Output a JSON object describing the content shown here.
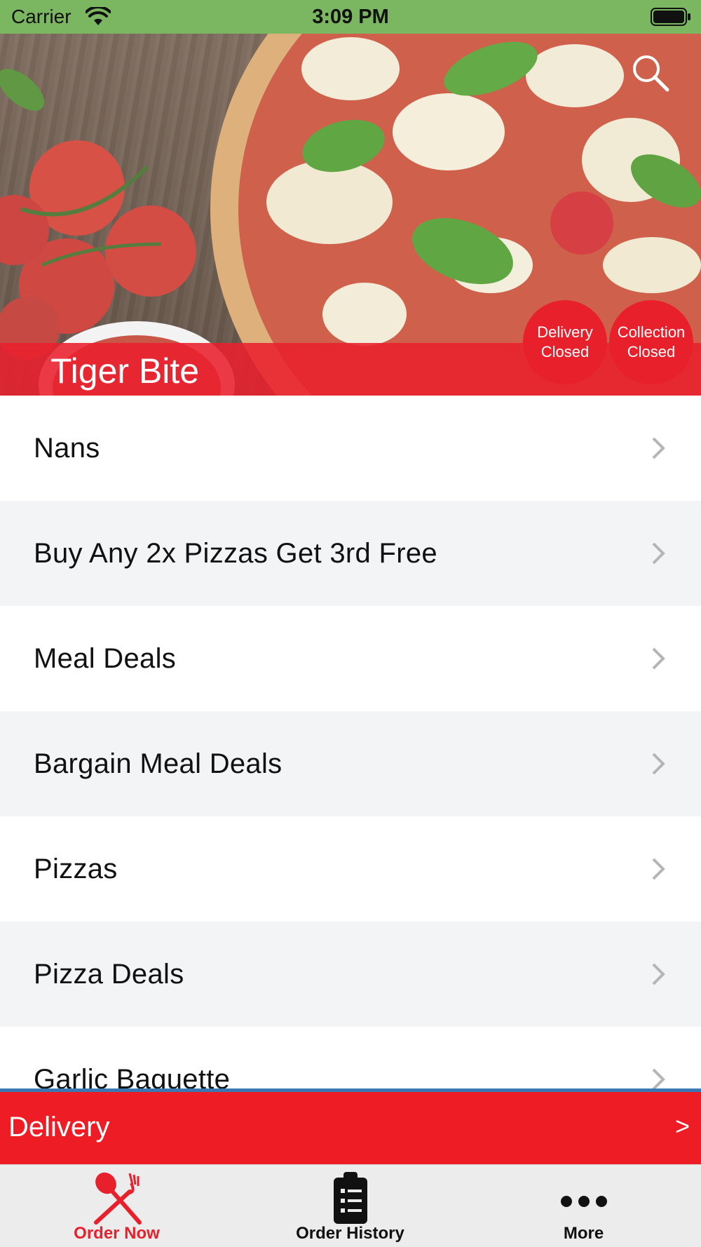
{
  "status_bar": {
    "carrier": "Carrier",
    "time": "3:09 PM"
  },
  "hero": {
    "restaurant_name": "Tiger Bite",
    "badges": [
      {
        "line1": "Delivery",
        "line2": "Closed"
      },
      {
        "line1": "Collection",
        "line2": "Closed"
      }
    ],
    "search_icon": "search-icon"
  },
  "menu": {
    "items": [
      {
        "label": "Nans"
      },
      {
        "label": "Buy Any 2x Pizzas Get 3rd Free"
      },
      {
        "label": "Meal Deals"
      },
      {
        "label": "Bargain Meal Deals"
      },
      {
        "label": "Pizzas"
      },
      {
        "label": "Pizza Deals"
      },
      {
        "label": "Garlic Baguette"
      }
    ],
    "chevron_icon": "chevron-right-icon"
  },
  "delivery_bar": {
    "label": "Delivery",
    "arrow": ">"
  },
  "tab_bar": {
    "tabs": [
      {
        "label": "Order Now",
        "icon": "fork-knife-icon",
        "active": true
      },
      {
        "label": "Order History",
        "icon": "clipboard-icon",
        "active": false
      },
      {
        "label": "More",
        "icon": "more-dots-icon",
        "active": false
      }
    ]
  },
  "colors": {
    "status_bar": "#7bb661",
    "accent_red": "#ee1c25",
    "badge_red": "#e8202c",
    "row_alt": "#f3f4f6",
    "divider_blue": "#3a78b5"
  }
}
